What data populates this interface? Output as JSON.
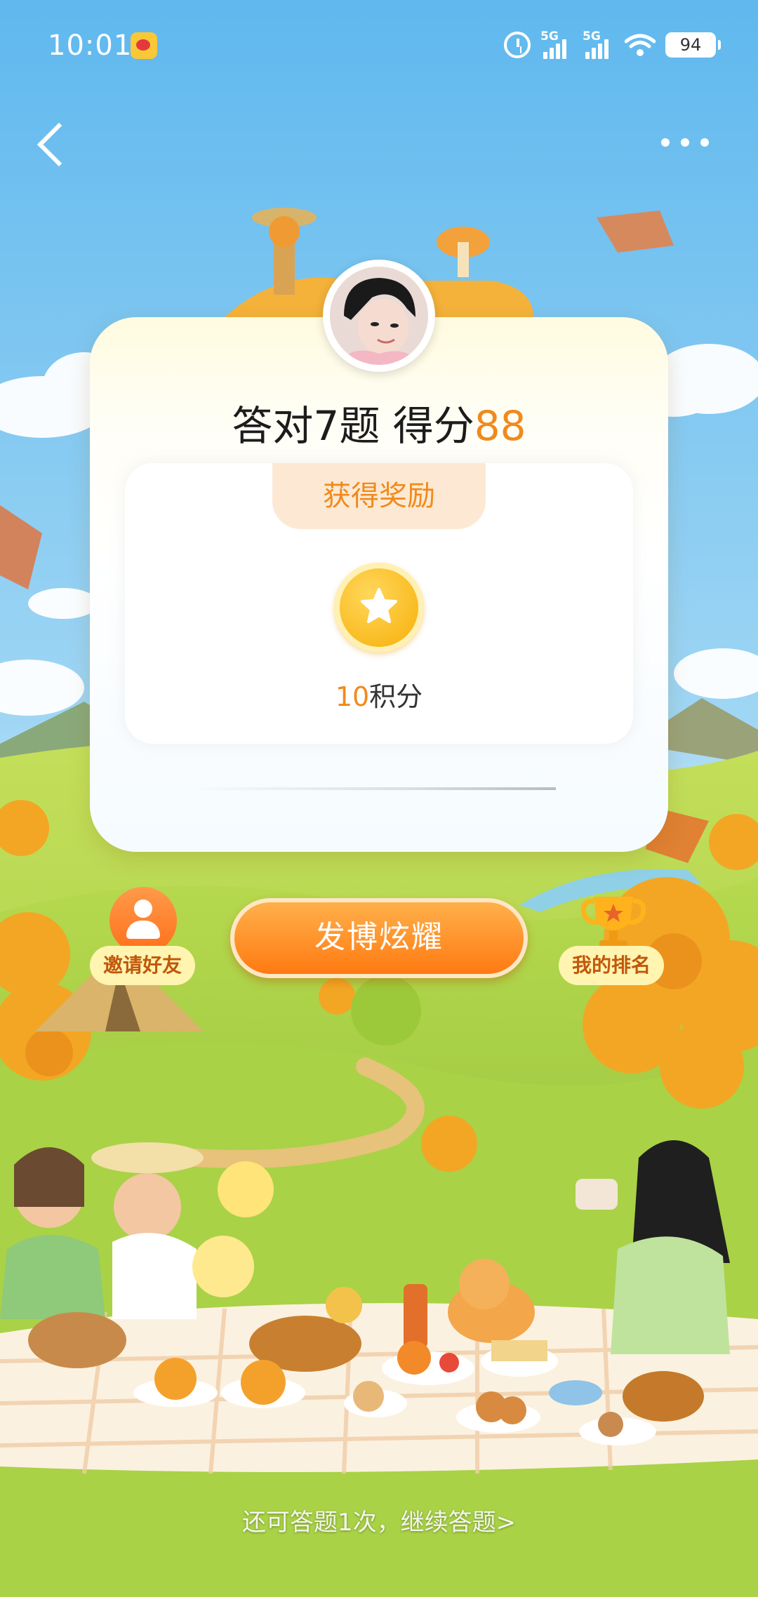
{
  "status_bar": {
    "time": "10:01",
    "network_1": "5G",
    "network_2": "5G",
    "battery": "94",
    "icons": [
      "weibo-app-icon",
      "alarm-icon",
      "signal-icon",
      "wifi-icon",
      "battery-icon"
    ]
  },
  "nav": {
    "back_icon": "chevron-left-icon",
    "more_icon": "more-dots-icon"
  },
  "result": {
    "score_prefix": "答对7题 得分",
    "score_value": "88"
  },
  "reward": {
    "tab_label": "获得奖励",
    "points_value": "10",
    "points_unit": "积分",
    "coin_icon": "star-coin-icon"
  },
  "actions": {
    "invite_label": "邀请好友",
    "share_label": "发博炫耀",
    "ranking_label": "我的排名"
  },
  "footer": {
    "retry_text": "还可答题1次，继续答题>"
  },
  "colors": {
    "accent": "#f08a1c",
    "button": "#ff7a12",
    "sky": "#7cc7f0",
    "grass": "#9fcf4a"
  }
}
